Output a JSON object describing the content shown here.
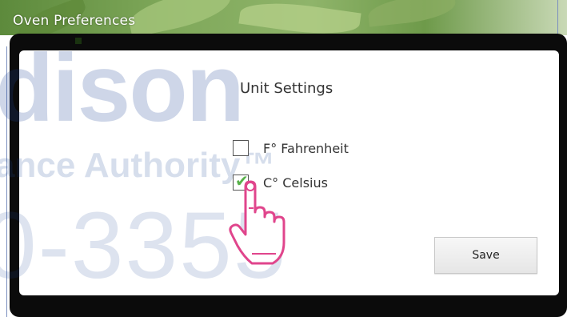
{
  "window": {
    "title": "Oven Preferences"
  },
  "dialog": {
    "section_title": "Unit Settings",
    "options": [
      {
        "label": "F° Fahrenheit",
        "checked": false
      },
      {
        "label": "C° Celsius",
        "checked": true
      }
    ],
    "save_label": "Save"
  },
  "watermark": {
    "line1": "dison",
    "line2": "ance Authority™",
    "line3": "0-3355"
  },
  "colors": {
    "frame": "#0b0b0b",
    "check_green": "#58b14a",
    "pointer_pink": "#e0458c",
    "watermark_blue": "#1e4696"
  },
  "icons": {
    "pointer": "hand-pointer-icon",
    "check": "checkmark-icon"
  }
}
